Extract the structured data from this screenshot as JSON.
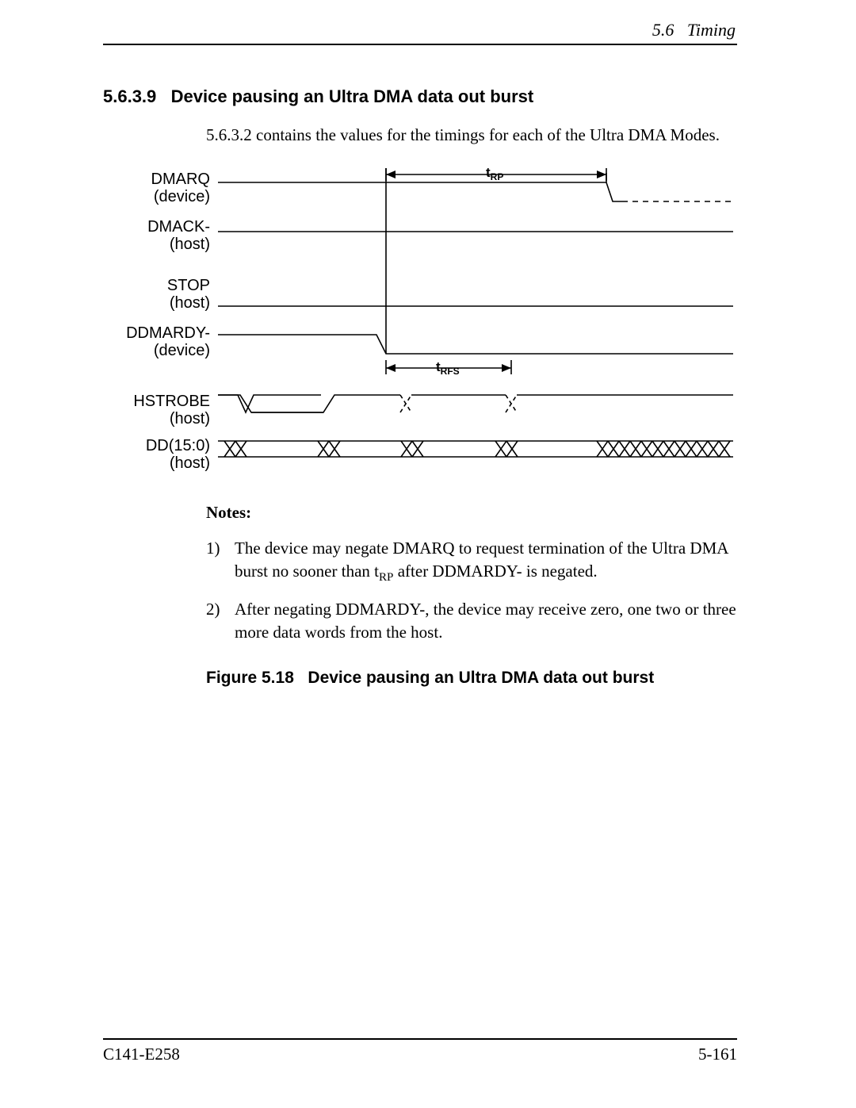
{
  "header": {
    "section_ref": "5.6",
    "section_name": "Timing"
  },
  "section": {
    "number": "5.6.3.9",
    "title": "Device pausing an Ultra DMA data out burst",
    "intro": "5.6.3.2 contains the values for the timings for each of the Ultra DMA Modes."
  },
  "diagram": {
    "signals": {
      "dmarq": {
        "name": "DMARQ",
        "origin": "(device)"
      },
      "dmack": {
        "name": "DMACK-",
        "origin": "(host)"
      },
      "stop": {
        "name": "STOP",
        "origin": "(host)"
      },
      "ddmardy": {
        "name": "DDMARDY-",
        "origin": "(device)"
      },
      "hstrobe": {
        "name": "HSTROBE",
        "origin": "(host)"
      },
      "dd": {
        "name": "DD(15:0)",
        "origin": "(host)"
      }
    },
    "timing_params": {
      "trp": {
        "prefix": "t",
        "sub": "RP"
      },
      "trfs": {
        "prefix": "t",
        "sub": "RFS"
      }
    }
  },
  "notes": {
    "heading": "Notes:",
    "items": [
      {
        "num": "1)",
        "pre": "The device may negate DMARQ to request termination of the Ultra DMA burst no sooner than t",
        "sub": "RP",
        "post": " after DDMARDY- is negated."
      },
      {
        "num": "2)",
        "pre": "After negating DDMARDY-, the device may receive zero, one two or three more data words from the host.",
        "sub": "",
        "post": ""
      }
    ]
  },
  "figure": {
    "label": "Figure 5.18",
    "caption": "Device pausing an Ultra DMA data out burst"
  },
  "footer": {
    "doc_id": "C141-E258",
    "page": "5-161"
  }
}
